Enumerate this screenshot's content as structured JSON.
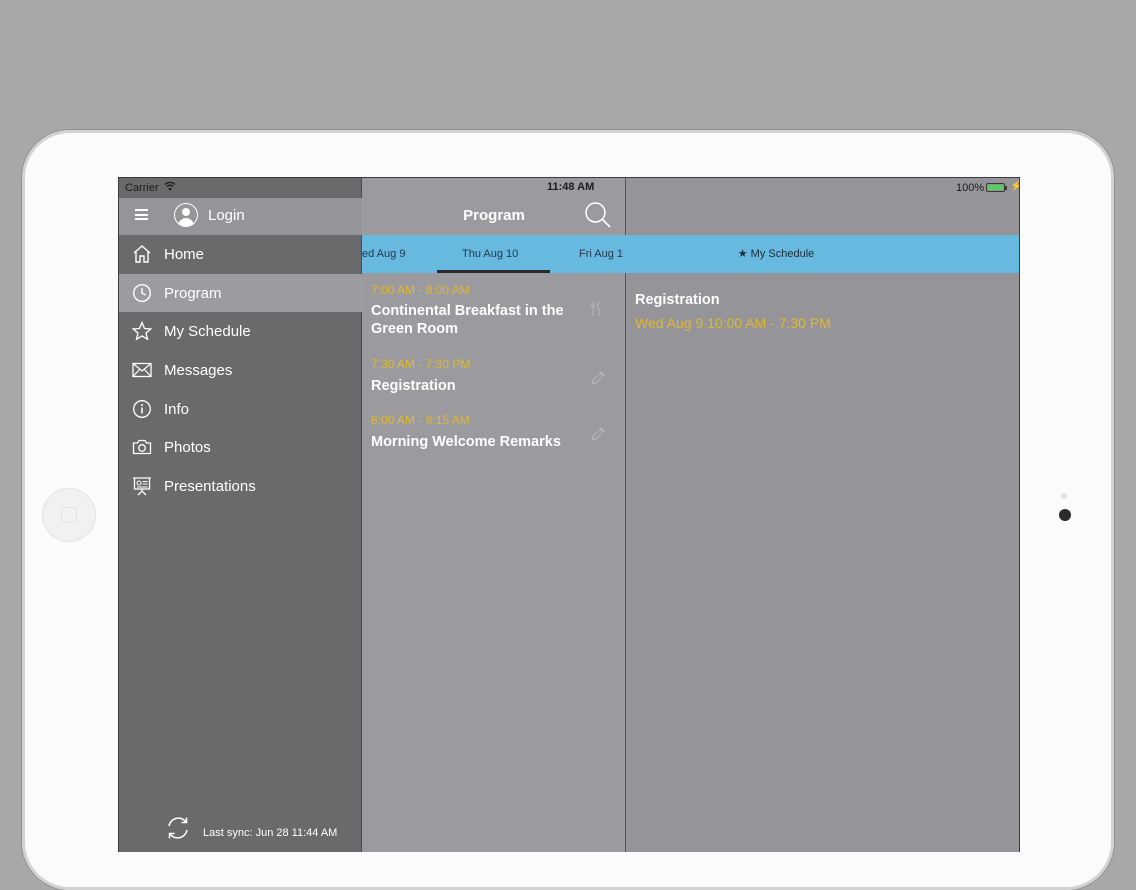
{
  "status_bar": {
    "carrier": "Carrier",
    "time": "11:48 AM",
    "battery": "100%"
  },
  "sidebar": {
    "login_label": "Login",
    "items": [
      {
        "label": "Home",
        "icon": "home-icon"
      },
      {
        "label": "Program",
        "icon": "clock-icon",
        "active": true
      },
      {
        "label": "My Schedule",
        "icon": "star-icon"
      },
      {
        "label": "Messages",
        "icon": "envelope-icon"
      },
      {
        "label": "Info",
        "icon": "info-icon"
      },
      {
        "label": "Photos",
        "icon": "camera-icon"
      },
      {
        "label": "Presentations",
        "icon": "presentation-icon"
      }
    ],
    "sync_label": "Last sync:  Jun 28 11:44 AM"
  },
  "program": {
    "title": "Program",
    "days": [
      {
        "label": "ed  Aug 9"
      },
      {
        "label": "Thu  Aug 10",
        "selected": true
      },
      {
        "label": "Fri  Aug 1"
      }
    ],
    "sessions": [
      {
        "time": "7:00 AM - 8:00 AM",
        "title": "Continental Breakfast in the Green Room",
        "icon": "fork-knife-icon"
      },
      {
        "time": "7:30 AM - 7:30 PM",
        "title": "Registration",
        "icon": "pencil-icon"
      },
      {
        "time": "8:00 AM - 8:15 AM",
        "title": "Morning Welcome Remarks",
        "icon": "pencil-icon"
      }
    ]
  },
  "detail": {
    "my_schedule_label": "My Schedule",
    "event_title": "Registration",
    "event_time": "Wed  Aug 9 10:00 AM - 7:30 PM"
  },
  "colors": {
    "accent": "#67b9df",
    "time_text": "#e0b830",
    "sidebar_bg": "#6a6a6c"
  }
}
